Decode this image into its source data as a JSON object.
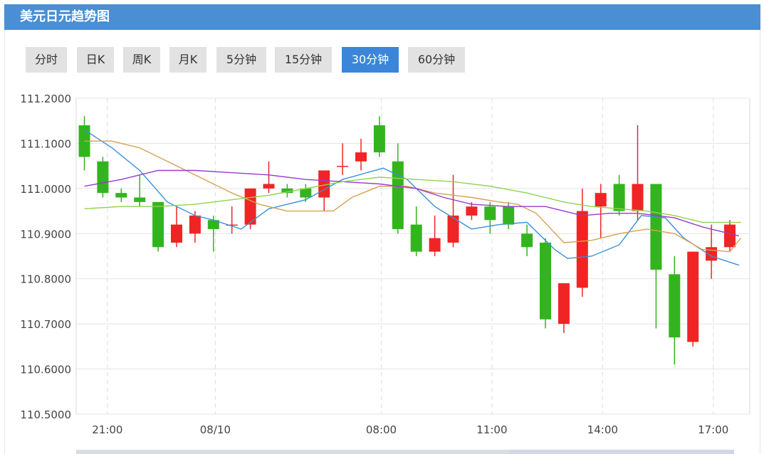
{
  "header": {
    "title": "美元日元趋势图"
  },
  "tabs": [
    {
      "label": "分时",
      "active": false
    },
    {
      "label": "日K",
      "active": false
    },
    {
      "label": "周K",
      "active": false
    },
    {
      "label": "月K",
      "active": false
    },
    {
      "label": "5分钟",
      "active": false
    },
    {
      "label": "15分钟",
      "active": false
    },
    {
      "label": "30分钟",
      "active": true
    },
    {
      "label": "60分钟",
      "active": false
    }
  ],
  "colors": {
    "up": "#f02424",
    "down": "#33b41f",
    "ma_blue": "#3a8fd8",
    "ma_orange": "#d9a050",
    "ma_purple": "#9a3ad0",
    "ma_green": "#8fd44a"
  },
  "chart_data": {
    "type": "candlestick",
    "ylim": [
      110.5,
      111.2
    ],
    "y_ticks": [
      "111.2000",
      "111.1000",
      "111.0000",
      "110.9000",
      "110.8000",
      "110.7000",
      "110.6000",
      "110.5000"
    ],
    "x_tick_labels": [
      {
        "label": "21:00",
        "index": 1.25
      },
      {
        "label": "08/10",
        "index": 7.1
      },
      {
        "label": "08:00",
        "index": 16.1
      },
      {
        "label": "11:00",
        "index": 22.1
      },
      {
        "label": "14:00",
        "index": 28.1
      },
      {
        "label": "17:00",
        "index": 34.1
      }
    ],
    "candles": [
      {
        "open": 111.14,
        "close": 111.07,
        "high": 111.16,
        "low": 111.04
      },
      {
        "open": 111.06,
        "close": 110.99,
        "high": 111.07,
        "low": 110.98
      },
      {
        "open": 110.99,
        "close": 110.98,
        "high": 111.0,
        "low": 110.97
      },
      {
        "open": 110.98,
        "close": 110.97,
        "high": 111.03,
        "low": 110.96
      },
      {
        "open": 110.97,
        "close": 110.87,
        "high": 110.97,
        "low": 110.86
      },
      {
        "open": 110.88,
        "close": 110.92,
        "high": 110.96,
        "low": 110.87
      },
      {
        "open": 110.9,
        "close": 110.94,
        "high": 110.95,
        "low": 110.88
      },
      {
        "open": 110.93,
        "close": 110.91,
        "high": 110.94,
        "low": 110.86
      },
      {
        "open": 110.92,
        "close": 110.92,
        "high": 110.96,
        "low": 110.9
      },
      {
        "open": 110.92,
        "close": 111.0,
        "high": 111.0,
        "low": 110.91
      },
      {
        "open": 111.0,
        "close": 111.01,
        "high": 111.06,
        "low": 110.99
      },
      {
        "open": 111.0,
        "close": 110.99,
        "high": 111.01,
        "low": 110.98
      },
      {
        "open": 111.0,
        "close": 110.98,
        "high": 111.01,
        "low": 110.97
      },
      {
        "open": 110.98,
        "close": 111.04,
        "high": 111.04,
        "low": 110.95
      },
      {
        "open": 111.05,
        "close": 111.05,
        "high": 111.1,
        "low": 111.03
      },
      {
        "open": 111.06,
        "close": 111.08,
        "high": 111.11,
        "low": 111.04
      },
      {
        "open": 111.14,
        "close": 111.08,
        "high": 111.16,
        "low": 111.07
      },
      {
        "open": 111.06,
        "close": 110.91,
        "high": 111.1,
        "low": 110.9
      },
      {
        "open": 110.92,
        "close": 110.86,
        "high": 110.96,
        "low": 110.85
      },
      {
        "open": 110.86,
        "close": 110.89,
        "high": 110.94,
        "low": 110.85
      },
      {
        "open": 110.88,
        "close": 110.94,
        "high": 111.03,
        "low": 110.87
      },
      {
        "open": 110.94,
        "close": 110.96,
        "high": 110.97,
        "low": 110.93
      },
      {
        "open": 110.96,
        "close": 110.93,
        "high": 110.97,
        "low": 110.9
      },
      {
        "open": 110.96,
        "close": 110.92,
        "high": 110.97,
        "low": 110.91
      },
      {
        "open": 110.9,
        "close": 110.87,
        "high": 110.92,
        "low": 110.85
      },
      {
        "open": 110.88,
        "close": 110.71,
        "high": 110.89,
        "low": 110.69
      },
      {
        "open": 110.7,
        "close": 110.79,
        "high": 110.79,
        "low": 110.68
      },
      {
        "open": 110.78,
        "close": 110.95,
        "high": 111.0,
        "low": 110.76
      },
      {
        "open": 110.96,
        "close": 110.99,
        "high": 111.01,
        "low": 110.89
      },
      {
        "open": 111.01,
        "close": 110.95,
        "high": 111.03,
        "low": 110.94
      },
      {
        "open": 110.95,
        "close": 111.01,
        "high": 111.14,
        "low": 110.93
      },
      {
        "open": 111.01,
        "close": 110.82,
        "high": 111.01,
        "low": 110.69
      },
      {
        "open": 110.81,
        "close": 110.67,
        "high": 110.85,
        "low": 110.61
      },
      {
        "open": 110.66,
        "close": 110.86,
        "high": 110.86,
        "low": 110.65
      },
      {
        "open": 110.84,
        "close": 110.87,
        "high": 110.92,
        "low": 110.8
      },
      {
        "open": 110.87,
        "close": 110.92,
        "high": 110.93,
        "low": 110.86
      }
    ],
    "series": [
      {
        "color_key": "ma_blue",
        "points": [
          [
            0,
            111.13
          ],
          [
            1.5,
            111.09
          ],
          [
            3,
            111.04
          ],
          [
            4.5,
            110.97
          ],
          [
            6,
            110.94
          ],
          [
            7,
            110.93
          ],
          [
            8.5,
            110.91
          ],
          [
            10,
            110.955
          ],
          [
            12,
            110.975
          ],
          [
            14,
            111.02
          ],
          [
            16.2,
            111.045
          ],
          [
            17.5,
            111.02
          ],
          [
            19,
            110.96
          ],
          [
            21,
            110.91
          ],
          [
            22.5,
            110.92
          ],
          [
            24,
            110.925
          ],
          [
            25.5,
            110.865
          ],
          [
            26.2,
            110.845
          ],
          [
            27.5,
            110.85
          ],
          [
            29,
            110.875
          ],
          [
            30.2,
            110.94
          ],
          [
            31.5,
            110.935
          ],
          [
            32.5,
            110.89
          ],
          [
            34,
            110.85
          ],
          [
            35.5,
            110.83
          ]
        ]
      },
      {
        "color_key": "ma_orange",
        "points": [
          [
            0,
            111.105
          ],
          [
            1.5,
            111.105
          ],
          [
            3,
            111.09
          ],
          [
            4.5,
            111.06
          ],
          [
            6,
            111.03
          ],
          [
            8,
            110.99
          ],
          [
            9.5,
            110.965
          ],
          [
            11,
            110.95
          ],
          [
            12.5,
            110.95
          ],
          [
            13.5,
            110.95
          ],
          [
            14.5,
            110.98
          ],
          [
            16,
            111.005
          ],
          [
            17.5,
            111.005
          ],
          [
            19,
            110.99
          ],
          [
            21,
            110.98
          ],
          [
            22.5,
            110.97
          ],
          [
            23.5,
            110.965
          ],
          [
            24.5,
            110.945
          ],
          [
            26,
            110.88
          ],
          [
            27.5,
            110.885
          ],
          [
            29,
            110.9
          ],
          [
            30.5,
            110.91
          ],
          [
            32,
            110.9
          ],
          [
            33.5,
            110.865
          ],
          [
            35,
            110.86
          ],
          [
            35.6,
            110.89
          ]
        ]
      },
      {
        "color_key": "ma_purple",
        "points": [
          [
            0,
            111.005
          ],
          [
            2,
            111.02
          ],
          [
            4,
            111.04
          ],
          [
            6,
            111.04
          ],
          [
            8,
            111.035
          ],
          [
            10,
            111.03
          ],
          [
            12,
            111.02
          ],
          [
            14,
            111.015
          ],
          [
            16,
            111.01
          ],
          [
            18,
            111.0
          ],
          [
            19.5,
            110.98
          ],
          [
            21,
            110.965
          ],
          [
            23,
            110.96
          ],
          [
            25,
            110.96
          ],
          [
            27,
            110.94
          ],
          [
            28.5,
            110.945
          ],
          [
            30,
            110.945
          ],
          [
            32,
            110.935
          ],
          [
            33.5,
            110.915
          ],
          [
            35.5,
            110.895
          ]
        ]
      },
      {
        "color_key": "ma_green",
        "points": [
          [
            0,
            110.955
          ],
          [
            2,
            110.96
          ],
          [
            4,
            110.96
          ],
          [
            6,
            110.965
          ],
          [
            8,
            110.975
          ],
          [
            10,
            110.985
          ],
          [
            12,
            111.0
          ],
          [
            14,
            111.015
          ],
          [
            16,
            111.025
          ],
          [
            18,
            111.02
          ],
          [
            20,
            111.015
          ],
          [
            22,
            111.005
          ],
          [
            24,
            110.99
          ],
          [
            26,
            110.97
          ],
          [
            27.5,
            110.96
          ],
          [
            29,
            110.955
          ],
          [
            30.5,
            110.95
          ],
          [
            32,
            110.94
          ],
          [
            33.5,
            110.925
          ],
          [
            35.6,
            110.925
          ]
        ]
      }
    ]
  }
}
